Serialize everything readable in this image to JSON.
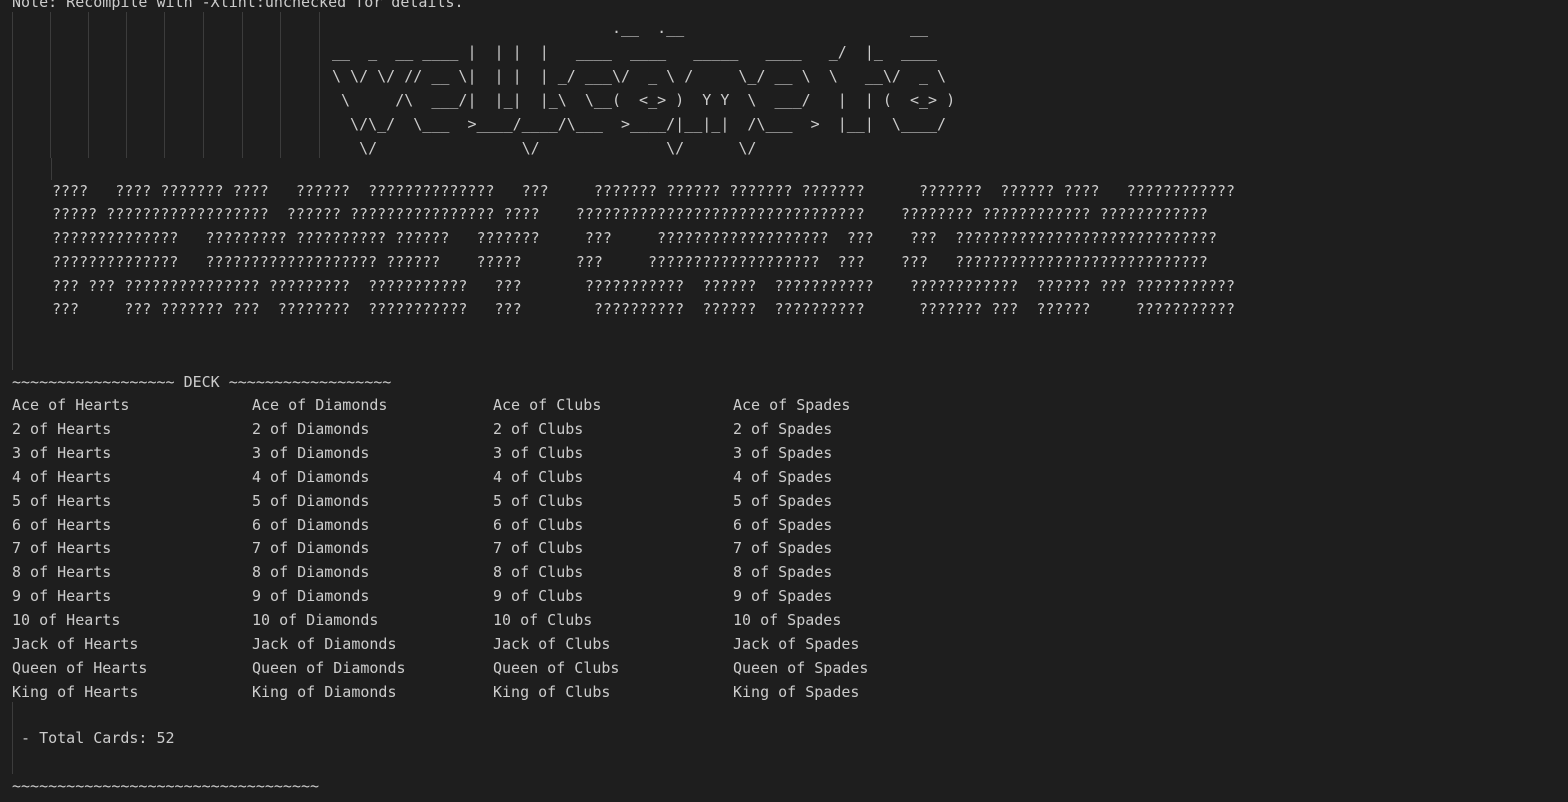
{
  "terminal": {
    "note": "Note: Recompile with -Xlint:unchecked for details.",
    "banner": [
      "                               .__  .__                         __",
      "__  _  __ ____ |  | |  |   ____  ____   _____   ____   _/  |_  ____",
      "\\ \\/ \\/ // __ \\|  | |  | _/ ___\\/  _ \\ /     \\_/ __ \\  \\   __\\/  _ \\",
      " \\     /\\  ___/|  |_|  |_\\  \\__(  <_> )  Y Y  \\  ___/   |  | (  <_> )",
      "  \\/\\_/  \\___  >____/____/\\___  >____/|__|_|  /\\___  >  |__|  \\____/",
      "   \\/                \\/              \\/      \\/"
    ],
    "garbled": [
      "????   ???? ??????? ????   ??????  ??????????????   ???     ??????? ?????? ??????? ???????      ???????  ?????? ????   ????????????",
      "????? ??????????????????  ?????? ???????????????? ????    ????????????????????????????????    ???????? ???????????? ????????????",
      "??????????????   ????????? ?????????? ??????   ???????     ???     ???????????????????  ???    ???  ?????????????????????????????",
      "??????????????   ??????????????????? ??????    ?????      ???     ???????????????????  ???    ???   ????????????????????????????",
      "??? ??? ??????????????? ?????????  ???????????   ???       ???????????  ??????  ???????????    ????????????  ?????? ??? ???????????",
      "???     ??? ??????? ???  ????????  ???????????   ???        ??????????  ??????  ??????????      ??????? ???  ??????     ???????????"
    ],
    "deck_header": "~~~~~~~~~~~~~~~~~~ DECK ~~~~~~~~~~~~~~~~~~",
    "columns": [
      [
        "Ace of Hearts",
        "2 of Hearts",
        "3 of Hearts",
        "4 of Hearts",
        "5 of Hearts",
        "6 of Hearts",
        "7 of Hearts",
        "8 of Hearts",
        "9 of Hearts",
        "10 of Hearts",
        "Jack of Hearts",
        "Queen of Hearts",
        "King of Hearts"
      ],
      [
        "Ace of Diamonds",
        "2 of Diamonds",
        "3 of Diamonds",
        "4 of Diamonds",
        "5 of Diamonds",
        "6 of Diamonds",
        "7 of Diamonds",
        "8 of Diamonds",
        "9 of Diamonds",
        "10 of Diamonds",
        "Jack of Diamonds",
        "Queen of Diamonds",
        "King of Diamonds"
      ],
      [
        "Ace of Clubs",
        "2 of Clubs",
        "3 of Clubs",
        "4 of Clubs",
        "5 of Clubs",
        "6 of Clubs",
        "7 of Clubs",
        "8 of Clubs",
        "9 of Clubs",
        "10 of Clubs",
        "Jack of Clubs",
        "Queen of Clubs",
        "King of Clubs"
      ],
      [
        "Ace of Spades",
        "2 of Spades",
        "3 of Spades",
        "4 of Spades",
        "5 of Spades",
        "6 of Spades",
        "7 of Spades",
        "8 of Spades",
        "9 of Spades",
        "10 of Spades",
        "Jack of Spades",
        "Queen of Spades",
        "King of Spades"
      ]
    ],
    "total_cards": " - Total Cards: 52",
    "bottom_rule": "~~~~~~~~~~~~~~~~~~~~~~~~~~~~~~~~~~"
  }
}
